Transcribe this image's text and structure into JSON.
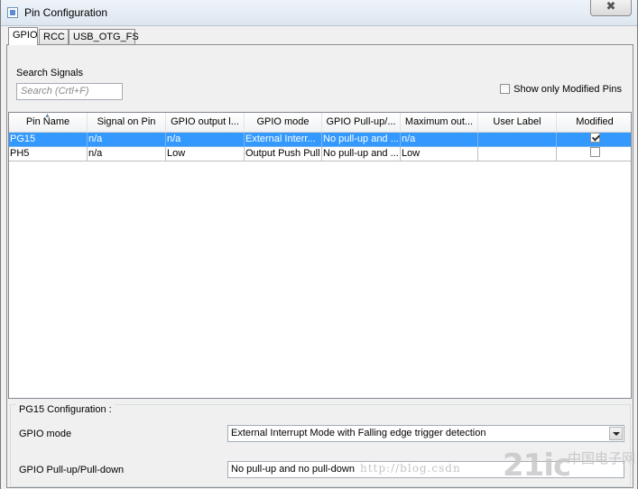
{
  "window": {
    "title": "Pin Configuration",
    "close_glyph": "✖"
  },
  "tabs": [
    {
      "label": "GPIO",
      "active": true
    },
    {
      "label": "RCC",
      "active": false
    },
    {
      "label": "USB_OTG_FS",
      "active": false
    }
  ],
  "search": {
    "label": "Search Signals",
    "placeholder": "Search (Crtl+F)"
  },
  "filter": {
    "show_modified_label": "Show only Modified Pins",
    "checked": false
  },
  "table": {
    "columns": [
      "Pin Name",
      "Signal on Pin",
      "GPIO output l...",
      "GPIO mode",
      "GPIO Pull-up/...",
      "Maximum out...",
      "User Label",
      "Modified"
    ],
    "sort_column": "Pin Name",
    "rows": [
      {
        "pin": "PG15",
        "signal": "n/a",
        "output_level": "n/a",
        "mode": "External Interr...",
        "pull": "No pull-up and ...",
        "max_speed": "n/a",
        "user_label": "",
        "modified": true,
        "selected": true
      },
      {
        "pin": "PH5",
        "signal": "n/a",
        "output_level": "Low",
        "mode": "Output Push Pull",
        "pull": "No pull-up and ...",
        "max_speed": "Low",
        "user_label": "",
        "modified": false,
        "selected": false
      }
    ]
  },
  "config": {
    "title": "PG15 Configuration :",
    "gpio_mode": {
      "label": "GPIO mode",
      "value": "External Interrupt Mode with Falling edge trigger detection"
    },
    "gpio_pull": {
      "label": "GPIO Pull-up/Pull-down",
      "value": "No pull-up and no pull-down"
    }
  },
  "watermark": {
    "url": "http://blog.csdn",
    "logo": "21ic",
    "cn": "中国电子网"
  },
  "colors": {
    "selection": "#3399ff",
    "title_bar": "#dde6f0",
    "panel": "#f0f0f0"
  }
}
